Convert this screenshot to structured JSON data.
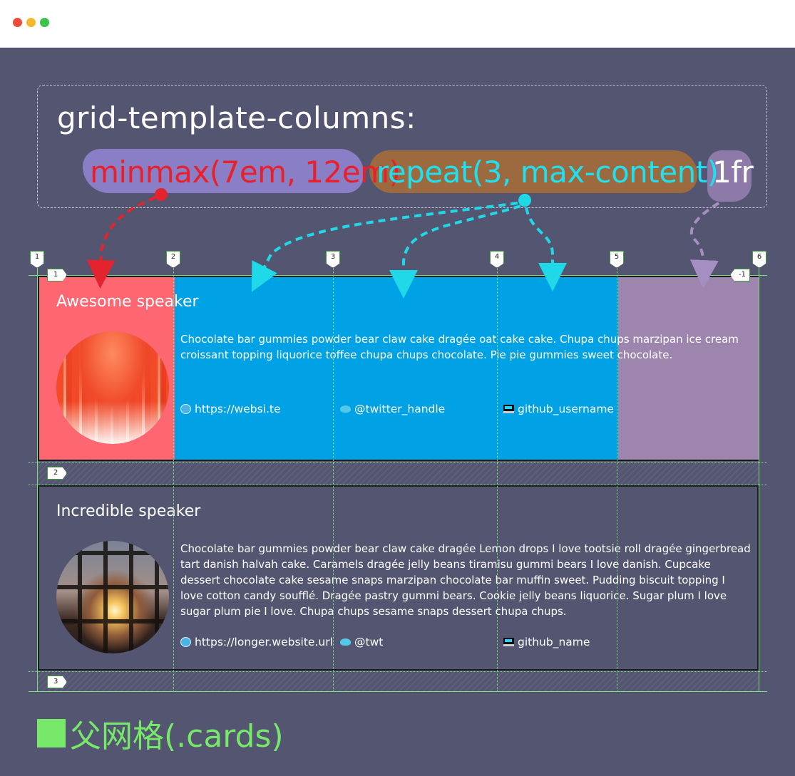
{
  "code": {
    "property": "grid-template-columns:",
    "tokens": {
      "minmax": "minmax(7em, 12em)",
      "repeat": "repeat(3, max-content)",
      "fr": "1fr"
    },
    "colors": {
      "minmax_text": "#e8202b",
      "repeat_text": "#1ee0ee",
      "fr_text": "#ffffff"
    }
  },
  "grid_lines": {
    "columns": [
      "1",
      "2",
      "3",
      "4",
      "5",
      "6"
    ],
    "rows": [
      "1",
      "2",
      "3"
    ],
    "negative_last_column": "-1",
    "line_color": "#79e37a"
  },
  "cards": [
    {
      "title": "Awesome speaker",
      "text": "Chocolate bar gummies powder bear claw cake dragée oat cake cake. Chupa chups marzipan ice cream croissant topping liquorice toffee chupa chups chocolate. Pie pie gummies sweet chocolate.",
      "links": [
        {
          "icon": "globe-icon",
          "label": "https://websi.te"
        },
        {
          "icon": "bird-icon",
          "label": "@twitter_handle"
        },
        {
          "icon": "computer-icon",
          "label": "github_username"
        }
      ],
      "colors": {
        "col1": "#fe6672",
        "cols2_4": "#00a2e6",
        "col5": "#9d85ae"
      }
    },
    {
      "title": "Incredible speaker",
      "text": "Chocolate bar gummies powder bear claw cake dragée Lemon drops I love tootsie roll dragée gingerbread tart danish halvah cake. Caramels dragée jelly beans tiramisu gummi bears I love danish. Cupcake dessert chocolate cake sesame snaps marzipan chocolate bar muffin sweet. Pudding biscuit topping I love cotton candy soufflé. Dragée pastry gummi bears. Cookie jelly beans liquorice. Sugar plum I love sugar plum pie I love. Chupa chups sesame snaps dessert chupa chups.",
      "links": [
        {
          "icon": "globe-icon",
          "label": "https://longer.website.url"
        },
        {
          "icon": "bird-icon",
          "label": "@twt"
        },
        {
          "icon": "computer-icon",
          "label": "github_name"
        }
      ]
    }
  ],
  "caption": "父网格(.cards)",
  "caption_color": "#77e86a"
}
